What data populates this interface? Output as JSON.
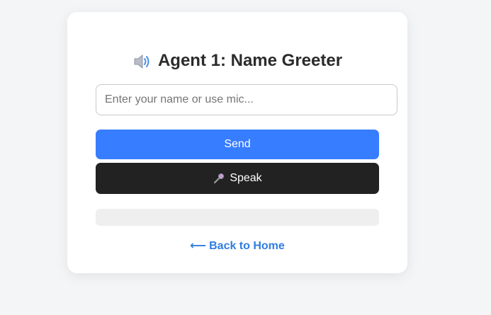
{
  "page": {
    "title_icon": "speaker-icon",
    "title": "Agent 1: Name Greeter"
  },
  "form": {
    "name_placeholder": "Enter your name or use mic...",
    "name_value": "",
    "send_label": "Send",
    "speak_icon": "microphone-icon",
    "speak_label": "Speak",
    "response_text": ""
  },
  "footer": {
    "back_arrow": "⟵",
    "back_label": "Back to Home"
  },
  "colors": {
    "accent": "#377dff",
    "speak_button": "#222222",
    "link": "#2f7de1",
    "background": "#f4f5f7"
  }
}
